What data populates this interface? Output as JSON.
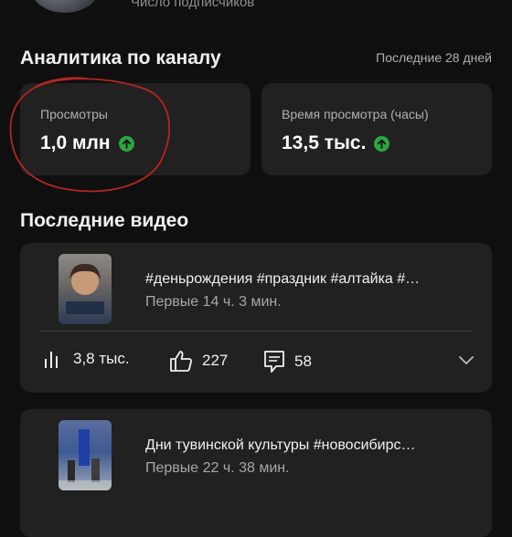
{
  "profile": {
    "subscribers_label": "Число подписчиков"
  },
  "analytics": {
    "title": "Аналитика по каналу",
    "range_label": "Последние 28 дней",
    "cards": [
      {
        "label": "Просмотры",
        "value": "1,0 млн",
        "trend": "up"
      },
      {
        "label": "Время просмотра (часы)",
        "value": "13,5 тыс.",
        "trend": "up"
      }
    ]
  },
  "recent_videos": {
    "title": "Последние видео",
    "items": [
      {
        "title": "#деньрождения #праздник #алтайка #…",
        "subtitle": "Первые 14 ч. 3 мин.",
        "views": "3,8 тыс.",
        "likes": "227",
        "comments": "58"
      },
      {
        "title": "Дни тувинской культуры #новосибирс…",
        "subtitle": "Первые 22 ч. 38 мин."
      }
    ]
  },
  "colors": {
    "background": "#0f0f0f",
    "card": "#212121",
    "trend_up": "#2ba640",
    "annotation": "#b3261e"
  }
}
